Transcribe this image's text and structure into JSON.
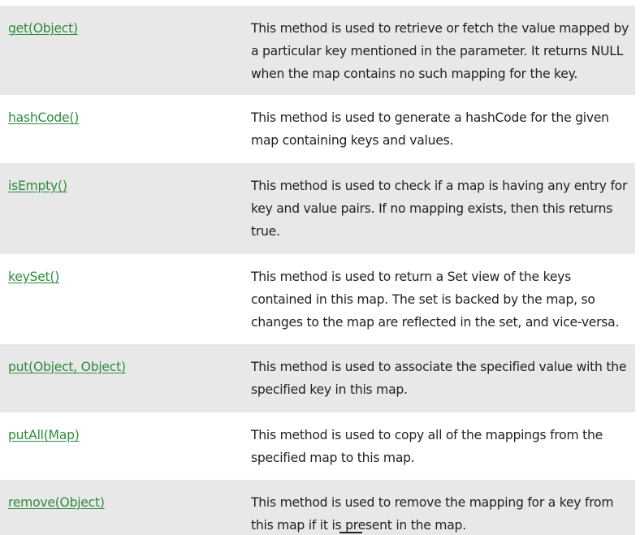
{
  "methods": [
    {
      "name": "get(Object)",
      "description": "This method is used to retrieve or fetch the value mapped by a particular key mentioned in the parameter. It returns NULL when the map contains no such mapping for the key."
    },
    {
      "name": "hashCode()",
      "description": "This method is used to generate a hashCode for the given map containing keys and values."
    },
    {
      "name": "isEmpty()",
      "description": "This method is used to check if a map is having any entry for key and value pairs. If no mapping exists, then this returns true."
    },
    {
      "name": "keySet()",
      "description": "This method is used to return a Set view of the keys contained in this map. The set is backed by the map, so changes to the map are reflected in the set, and vice-versa."
    },
    {
      "name": "put(Object, Object)",
      "description": "This method is used to associate the specified value with the specified key in this map."
    },
    {
      "name": "putAll(Map)",
      "description": "This method is used to copy all of the mappings from the specified map to this map."
    },
    {
      "name": "remove(Object)",
      "description": "This method is used to remove the mapping for a key from this map if it is present in the map."
    }
  ],
  "colors": {
    "link": "#2e8b3d",
    "shaded_row": "#e8e8e8",
    "text": "#222222"
  }
}
